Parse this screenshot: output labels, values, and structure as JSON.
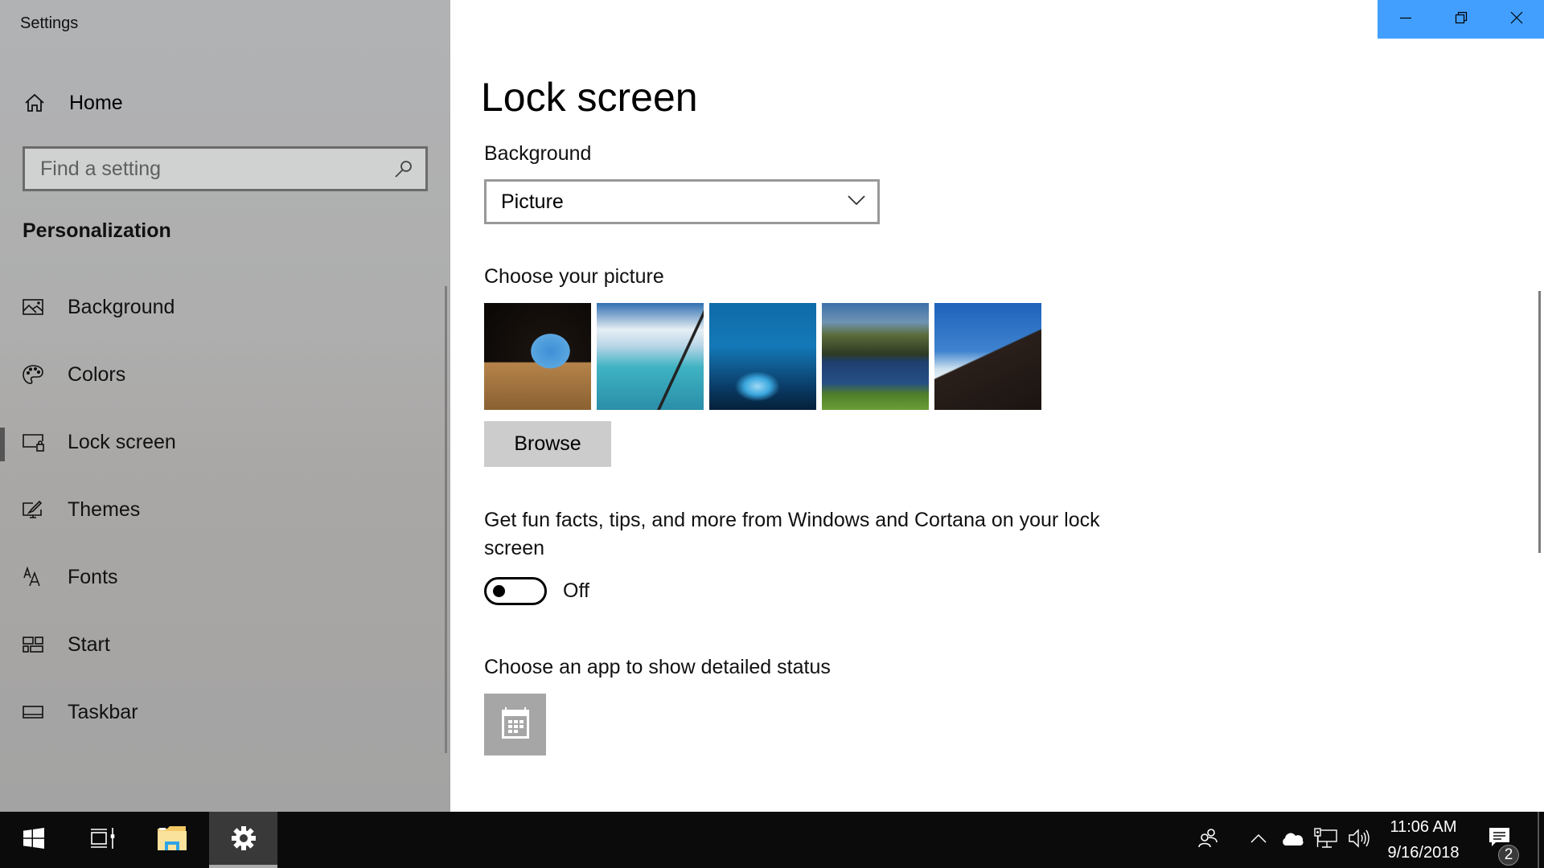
{
  "window": {
    "title": "Settings",
    "controls": {
      "minimize": "minimize",
      "restore": "restore",
      "close": "close"
    },
    "accent_color": "#429ffe"
  },
  "sidebar": {
    "home_label": "Home",
    "search": {
      "placeholder": "Find a setting",
      "value": ""
    },
    "section_heading": "Personalization",
    "items": [
      {
        "label": "Background",
        "icon": "picture-icon",
        "active": false
      },
      {
        "label": "Colors",
        "icon": "palette-icon",
        "active": false
      },
      {
        "label": "Lock screen",
        "icon": "lock-screen-icon",
        "active": true
      },
      {
        "label": "Themes",
        "icon": "themes-icon",
        "active": false
      },
      {
        "label": "Fonts",
        "icon": "fonts-icon",
        "active": false
      },
      {
        "label": "Start",
        "icon": "start-icon",
        "active": false
      },
      {
        "label": "Taskbar",
        "icon": "taskbar-icon",
        "active": false
      }
    ]
  },
  "main": {
    "page_title": "Lock screen",
    "background": {
      "label": "Background",
      "selected": "Picture"
    },
    "choose_picture": {
      "label": "Choose your picture",
      "thumbnails": [
        {
          "description": "Beach viewed through a cave opening"
        },
        {
          "description": "Aerial view of turquoise sea from aircraft window"
        },
        {
          "description": "Blue ice cave"
        },
        {
          "description": "Mountain lake reflection"
        },
        {
          "description": "Hiker on a ridge above clouds"
        }
      ],
      "browse_label": "Browse"
    },
    "fun_facts": {
      "label": "Get fun facts, tips, and more from Windows and Cortana on your lock screen",
      "state": "Off",
      "on": false
    },
    "detailed_status": {
      "label": "Choose an app to show detailed status",
      "app_icon": "calendar-icon"
    }
  },
  "taskbar": {
    "buttons": [
      {
        "name": "start",
        "icon": "windows-logo-icon"
      },
      {
        "name": "task-view",
        "icon": "task-view-icon"
      },
      {
        "name": "file-explorer",
        "icon": "folder-icon"
      },
      {
        "name": "settings",
        "icon": "gear-icon",
        "active": true
      }
    ],
    "tray": {
      "icons": [
        "people-icon",
        "chevron-up-icon",
        "onedrive-cloud-icon",
        "network-icon",
        "volume-icon"
      ],
      "time": "11:06 AM",
      "date": "9/16/2018",
      "notification_count": "2"
    }
  }
}
